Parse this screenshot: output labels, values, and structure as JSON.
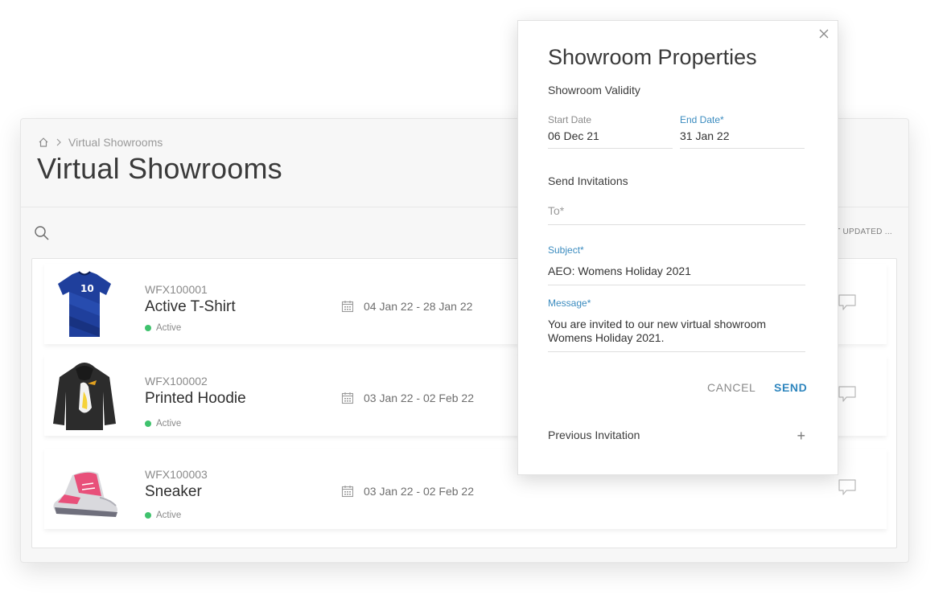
{
  "header": {
    "breadcrumb": "Virtual Showrooms",
    "title": "Virtual Showrooms",
    "sort_label": "T UPDATED ..."
  },
  "rows": [
    {
      "code": "WFX100001",
      "name": "Active T-Shirt",
      "status": "Active",
      "dates": "04 Jan 22 - 28 Jan 22",
      "thumb": "tshirt-image"
    },
    {
      "code": "WFX100002",
      "name": "Printed Hoodie",
      "status": "Active",
      "dates": "03 Jan 22 - 02 Feb 22",
      "thumb": "hoodie-image"
    },
    {
      "code": "WFX100003",
      "name": "Sneaker",
      "status": "Active",
      "dates": "03 Jan 22 - 02 Feb 22",
      "thumb": "sneaker-image"
    }
  ],
  "modal": {
    "title": "Showroom Properties",
    "validity_label": "Showroom Validity",
    "start_date_label": "Start Date",
    "start_date_value": "06 Dec 21",
    "end_date_label": "End Date*",
    "end_date_value": "31 Jan 22",
    "invitations_label": "Send Invitations",
    "to_placeholder": "To*",
    "subject_label": "Subject*",
    "subject_value": "AEO: Womens Holiday 2021",
    "message_label": "Message*",
    "message_line1": "You are invited to our new virtual showroom",
    "message_line2": "Womens Holiday 2021.",
    "cancel_label": "CANCEL",
    "send_label": "SEND",
    "previous_invitation_label": "Previous Invitation",
    "plus_symbol": "+"
  },
  "colors": {
    "accent": "#2f86be",
    "status_active": "#3fc26d",
    "tshirt_blue": "#1f3f9c",
    "sneaker_pink": "#e8507a"
  }
}
